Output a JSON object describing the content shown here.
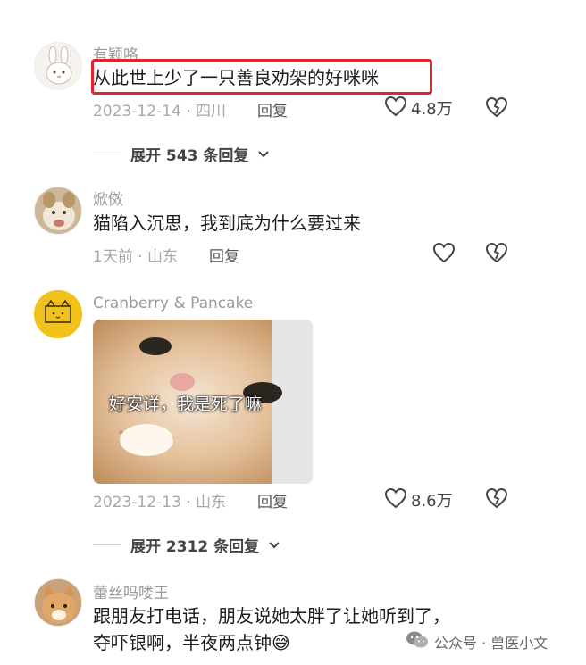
{
  "comments": [
    {
      "username": "有颖咯",
      "text": "从此世上少了一只善良劝架的好咪咪",
      "date_location": "2023-12-14 · 四川",
      "reply_label": "回复",
      "likes": "4.8万",
      "expand_label": "展开 543 条回复"
    },
    {
      "username": "焮傚",
      "text": "猫陷入沉思，我到底为什么要过来",
      "date_location": "1天前 · 山东",
      "reply_label": "回复",
      "likes": ""
    },
    {
      "username": "Cranberry & Pancake",
      "image_caption": "好安详，我是死了嘛",
      "date_location": "2023-12-13 · 山东",
      "reply_label": "回复",
      "likes": "8.6万",
      "expand_label": "展开 2312 条回复"
    },
    {
      "username": "蕾丝吗喽王",
      "text_line1": "跟朋友打电话，朋友说她太胖了让她听到了，",
      "text_line2": "夺吓银啊，半夜两点钟",
      "emoji": "😅"
    }
  ],
  "watermark": {
    "text": "公众号 · 兽医小文",
    "icon": "wechat-icon"
  },
  "colors": {
    "highlight": "#e0242e",
    "meta": "#a8a8a8",
    "username": "#9a9a9a"
  }
}
